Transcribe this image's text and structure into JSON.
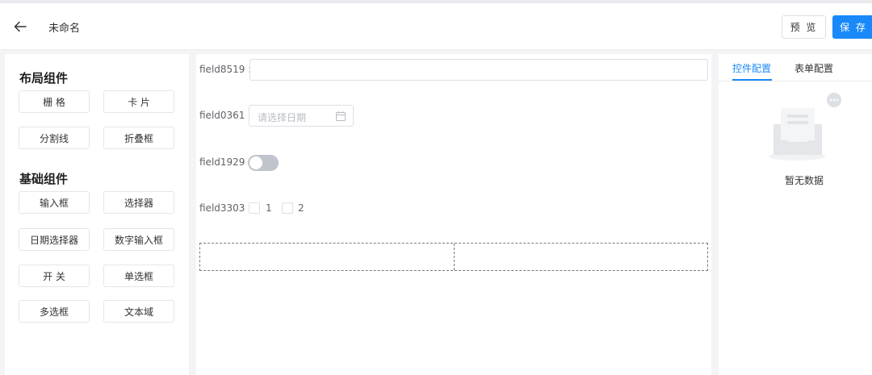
{
  "header": {
    "title": "未命名",
    "preview_label": "预 览",
    "save_label": "保 存"
  },
  "left_panel": {
    "layout_title": "布局组件",
    "layout_items": [
      "栅 格",
      "卡 片",
      "分割线",
      "折叠框"
    ],
    "basic_title": "基础组件",
    "basic_items": [
      "输入框",
      "选择器",
      "日期选择器",
      "数字输入框",
      "开 关",
      "单选框",
      "多选框",
      "文本域"
    ]
  },
  "canvas": {
    "fields": [
      {
        "label": "field8519 :",
        "type": "input",
        "value": ""
      },
      {
        "label": "field0361 :",
        "type": "date",
        "placeholder": "请选择日期"
      },
      {
        "label": "field1929 :",
        "type": "switch",
        "on": false
      },
      {
        "label": "field3303 :",
        "type": "checkbox",
        "options": [
          "1",
          "2"
        ]
      }
    ],
    "grid_columns": 2
  },
  "right_panel": {
    "tabs": [
      "控件配置",
      "表单配置"
    ],
    "active_tab": 0,
    "empty_text": "暂无数据"
  },
  "colors": {
    "accent": "#1989fa",
    "background": "#f3f4f6",
    "border": "#dcdfe6"
  },
  "icons": [
    "back-arrow-icon",
    "calendar-icon",
    "empty-inbox-icon",
    "chat-bubble-icon"
  ]
}
